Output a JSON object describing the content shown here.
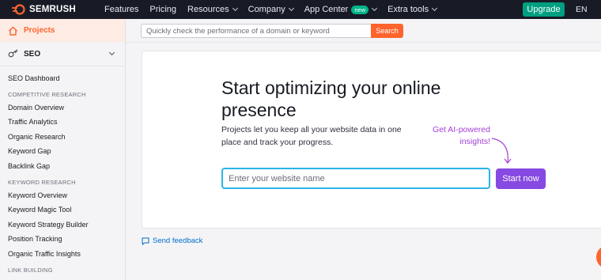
{
  "topbar": {
    "logo_text": "SEMRUSH",
    "nav": [
      {
        "label": "Features",
        "has_menu": false
      },
      {
        "label": "Pricing",
        "has_menu": false
      },
      {
        "label": "Resources",
        "has_menu": true
      },
      {
        "label": "Company",
        "has_menu": true
      },
      {
        "label": "App Center",
        "has_menu": true,
        "badge": "new"
      },
      {
        "label": "Extra tools",
        "has_menu": true
      }
    ],
    "upgrade_label": "Upgrade",
    "language": "EN"
  },
  "sidebar": {
    "projects_label": "Projects",
    "seo_label": "SEO",
    "seo_dashboard": "SEO Dashboard",
    "competitive_research_heading": "COMPETITIVE RESEARCH",
    "competitive_items": [
      "Domain Overview",
      "Traffic Analytics",
      "Organic Research",
      "Keyword Gap",
      "Backlink Gap"
    ],
    "keyword_research_heading": "KEYWORD RESEARCH",
    "keyword_items": [
      "Keyword Overview",
      "Keyword Magic Tool",
      "Keyword Strategy Builder",
      "Position Tracking",
      "Organic Traffic Insights"
    ],
    "link_building_heading": "LINK BUILDING"
  },
  "search": {
    "placeholder": "Quickly check the performance of a domain or keyword",
    "button_label": "Search"
  },
  "main": {
    "headline": "Start optimizing your online presence",
    "description": "Projects let you keep all your website data in one place and track your progress.",
    "ai_note": "Get AI-powered insights!",
    "website_placeholder": "Enter your website name",
    "start_label": "Start now",
    "feedback_label": "Send feedback"
  },
  "colors": {
    "brand_orange": "#ff642d",
    "upgrade_green": "#009f81",
    "start_purple": "#8649e1",
    "ai_purple": "#a33ed7",
    "link_blue": "#006dca"
  }
}
